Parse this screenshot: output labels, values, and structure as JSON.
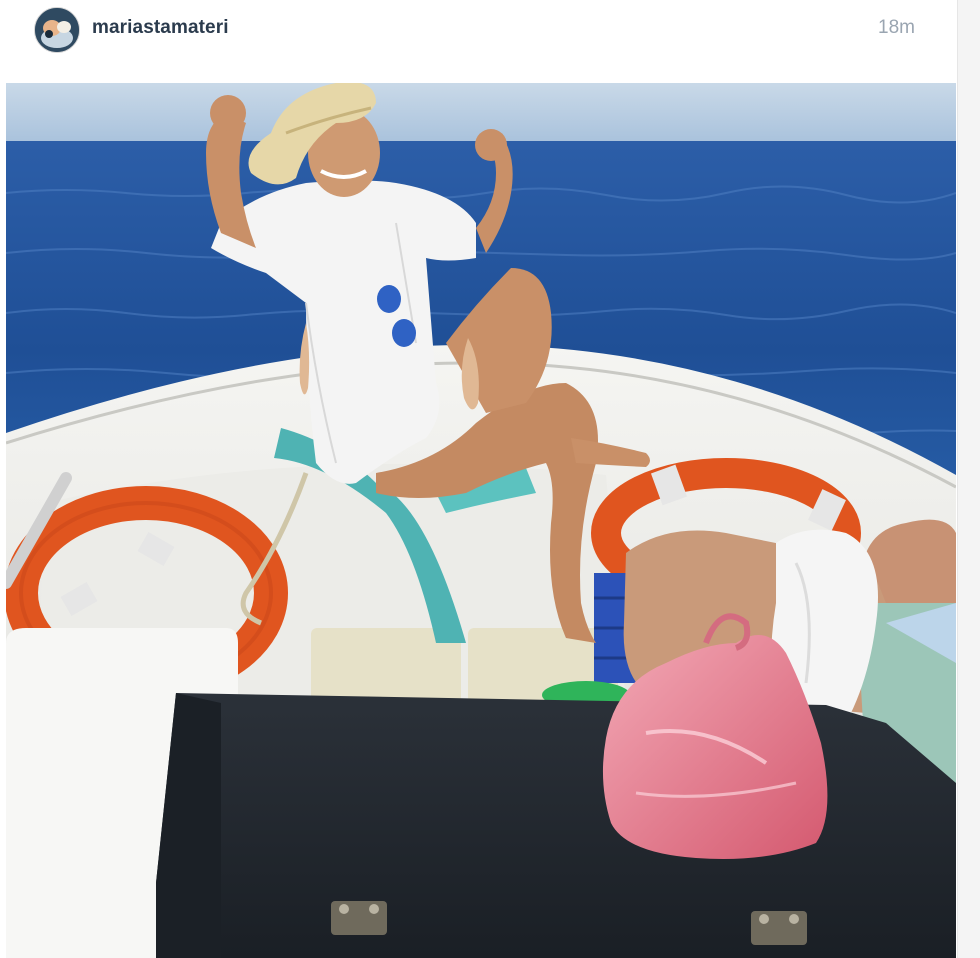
{
  "post": {
    "username": "mariastamateri",
    "timestamp": "18m",
    "avatar_icon": "profile-avatar-icon",
    "photo_icon": "post-photo-image"
  },
  "colors": {
    "username": "#2b3b4d",
    "timestamp": "#9aa5b1",
    "sky": "#b9cfe4",
    "sea": "#1d4f9a",
    "boat": "#f2f2ef",
    "lifebuoy": "#e0551f"
  }
}
